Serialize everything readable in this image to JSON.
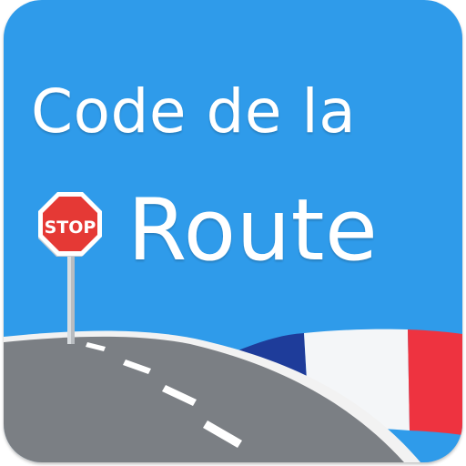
{
  "app_icon": {
    "title_line_1": "Code de la",
    "title_line_2": "Route",
    "stop_sign_text": "STOP"
  },
  "colors": {
    "background": "#2f9bea",
    "title_text": "#ffffff",
    "stop_sign": "#e53935",
    "road": "#7b7f84",
    "road_edge": "#f2f2f2",
    "flag_blue": "#1e3c9a",
    "flag_white": "#f4f6f8",
    "flag_red": "#ee3340"
  },
  "icons": {
    "stop_sign": "stop-sign-icon",
    "road": "road-icon",
    "flag": "french-flag-icon"
  }
}
